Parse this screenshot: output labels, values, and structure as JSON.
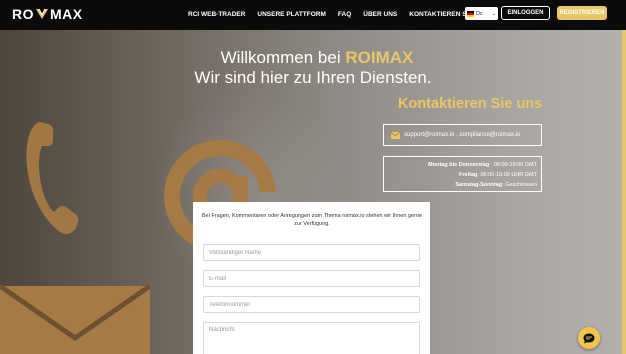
{
  "brand": {
    "logo_left": "RO",
    "logo_right": "MAX"
  },
  "nav": {
    "links": [
      "RCI WEB-TRADER",
      "UNSERE PLATTFORM",
      "FAQ",
      "ÜBER UNS",
      "KONTAKTIEREN SIE UNS"
    ],
    "language": "Dc",
    "login_label": "EINLOGGEN",
    "register_label": "REGISTRIEREN"
  },
  "hero": {
    "welcome": "Willkommen bei",
    "brand": "ROIMAX",
    "subtitle": "Wir sind hier zu Ihren Diensten.",
    "contact_title": "Kontaktieren Sie uns",
    "emails": "support@roimax.io , compliance@roimax.io",
    "hours": [
      {
        "day": "Montag bis Donnerstag",
        "time": " : 06:00-19:00 GMT"
      },
      {
        "day": "Freitag",
        "time": ": 06:00-16:00 UHR GMT"
      },
      {
        "day": "Samstag-Sonntag",
        "time": ": Geschlossen"
      }
    ]
  },
  "form": {
    "intro": "Bei Fragen, Kommentaren oder Anregungen zum Thema roimax.io stehen wir Ihnen gerne zur Verfügung.",
    "name_placeholder": "Vollständiger Name",
    "email_placeholder": "E-mail",
    "phone_placeholder": "Telefonnummer",
    "message_placeholder": "Nachricht"
  },
  "colors": {
    "accent": "#e8c766",
    "navbar": "#0b0b0b",
    "icon_bronze": "#a57a44"
  },
  "icons": [
    "phone-icon",
    "at-sign-icon",
    "envelope-icon",
    "mail-icon",
    "chat-icon",
    "chevron-down-icon",
    "flag-de-icon"
  ]
}
